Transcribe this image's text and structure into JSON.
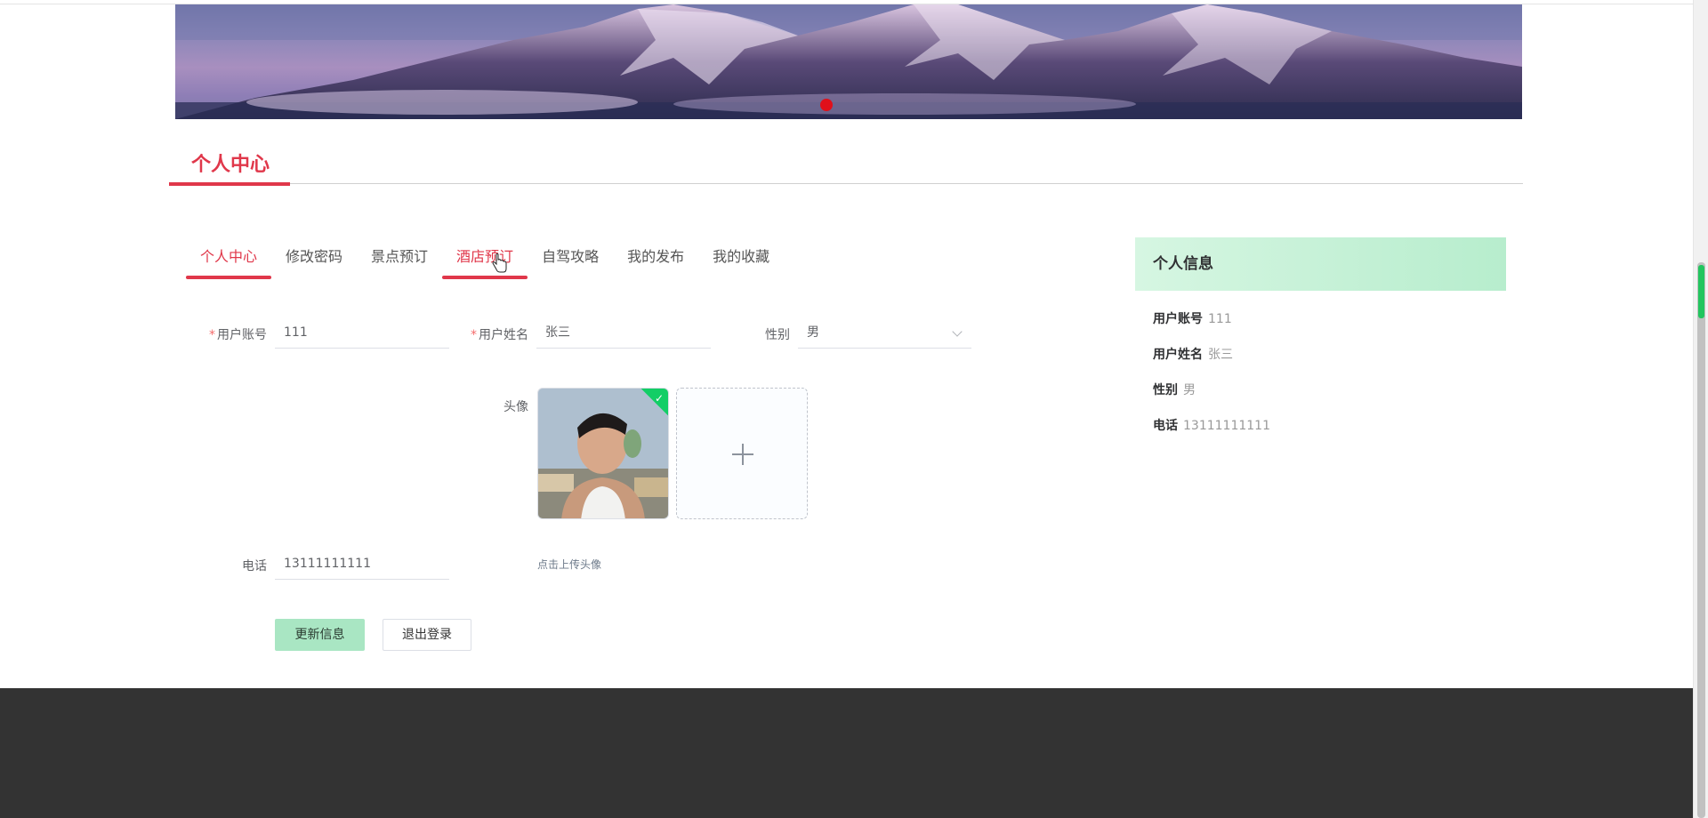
{
  "section_title": "个人中心",
  "tabs": [
    {
      "label": "个人中心",
      "state": "active"
    },
    {
      "label": "修改密码",
      "state": ""
    },
    {
      "label": "景点预订",
      "state": ""
    },
    {
      "label": "酒店预订",
      "state": "hover"
    },
    {
      "label": "自驾攻略",
      "state": ""
    },
    {
      "label": "我的发布",
      "state": ""
    },
    {
      "label": "我的收藏",
      "state": ""
    }
  ],
  "form": {
    "required_mark": "*",
    "account_label": "用户账号",
    "account_value": "111",
    "name_label": "用户姓名",
    "name_value": "张三",
    "gender_label": "性别",
    "gender_value": "男",
    "avatar_label": "头像",
    "avatar_check": "✓",
    "phone_label": "电话",
    "phone_value": "13111111111",
    "upload_tip": "点击上传头像",
    "update_button": "更新信息",
    "logout_button": "退出登录"
  },
  "info": {
    "title": "个人信息",
    "account_key": "用户账号",
    "account_value": "111",
    "name_key": "用户姓名",
    "name_value": "张三",
    "gender_key": "性别",
    "gender_value": "男",
    "phone_key": "电话",
    "phone_value": "13111111111"
  },
  "colors": {
    "accent": "#e0374a",
    "primary_button": "#a9e6c3",
    "footer": "#333333"
  }
}
